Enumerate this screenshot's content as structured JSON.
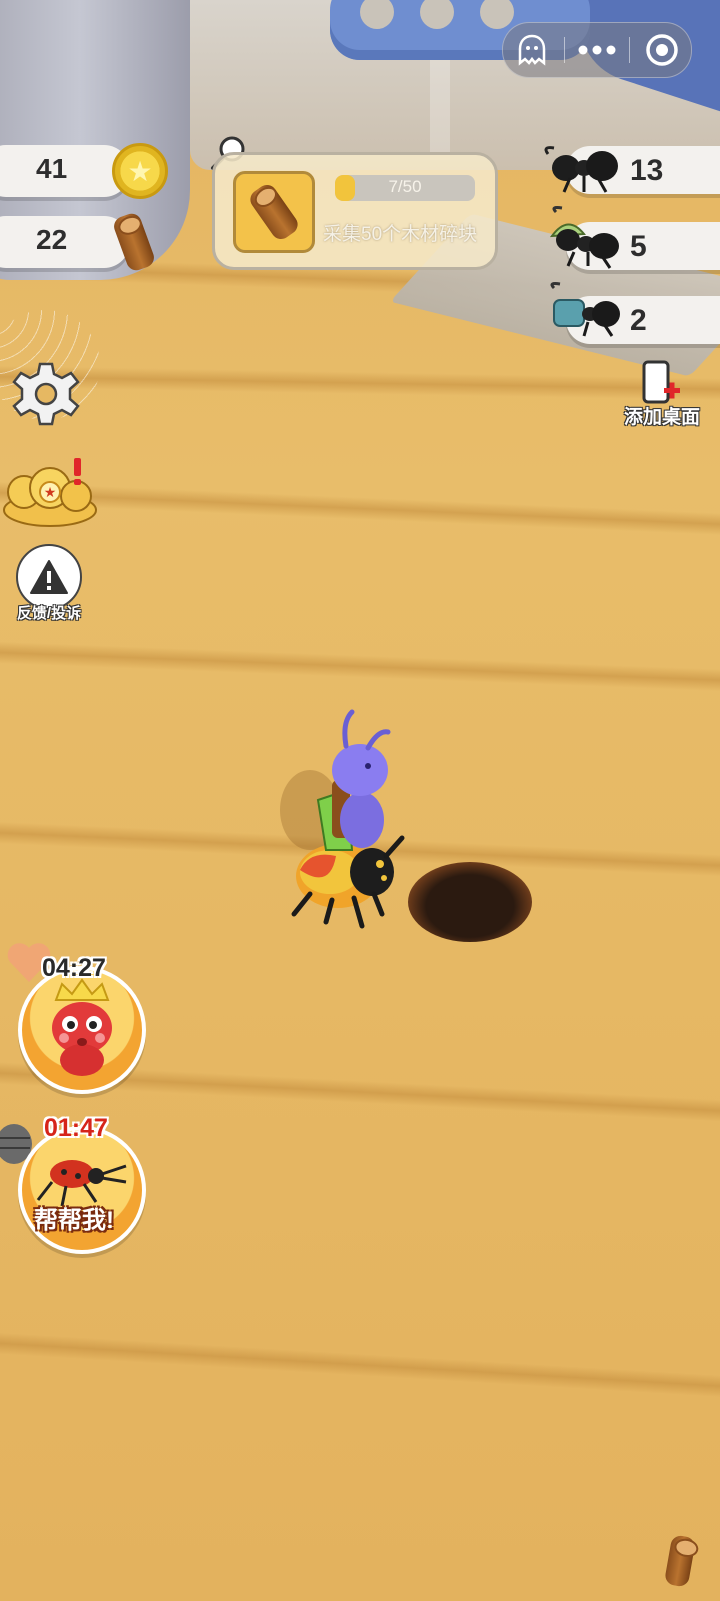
{
  "capsule": {
    "ghost_icon": "ghost-icon",
    "more_icon": "more-icon",
    "close_icon": "close-circle-icon"
  },
  "resources": {
    "coins": "41",
    "wood": "22"
  },
  "quest": {
    "progress_text": "7/50",
    "progress_value": 7,
    "progress_max": 50,
    "description": "采集50个木材碎块"
  },
  "ants": [
    {
      "count": "13",
      "type": "worker"
    },
    {
      "count": "5",
      "type": "soldier"
    },
    {
      "count": "2",
      "type": "carrier"
    }
  ],
  "add_desktop_label": "添加桌面",
  "feedback_label": "反馈/投诉",
  "events": [
    {
      "timer": "04:27",
      "name": "queen"
    },
    {
      "timer": "01:47",
      "label": "帮帮我!"
    }
  ],
  "colors": {
    "floor": "#e6b862",
    "accent": "#f2c43c",
    "timer_red": "#d6241a"
  }
}
